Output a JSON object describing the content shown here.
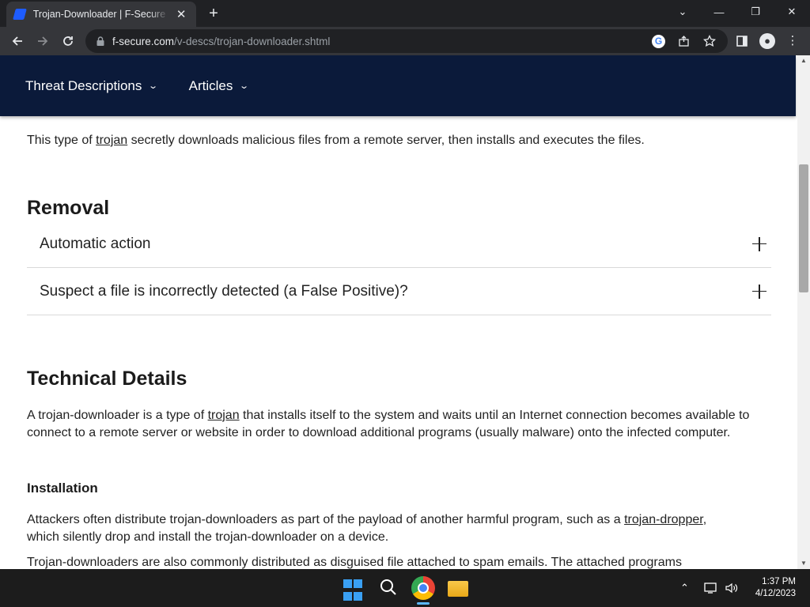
{
  "browser": {
    "tab_title": "Trojan-Downloader | F-Secure Labs",
    "tab_close": "✕",
    "new_tab": "+",
    "url_host": "f-secure.com",
    "url_path": "/v-descs/trojan-downloader.shtml",
    "window_controls": {
      "tab_search": "⌄",
      "minimize": "—",
      "restore": "❐",
      "close": "✕"
    }
  },
  "site_nav": {
    "items": [
      {
        "label": "Threat Descriptions"
      },
      {
        "label": "Articles"
      }
    ]
  },
  "article": {
    "intro_pre": "This type of ",
    "intro_link": "trojan",
    "intro_post": " secretly downloads malicious files from a remote server, then installs and executes the files.",
    "removal_heading": "Removal",
    "accordion": [
      {
        "label": "Automatic action"
      },
      {
        "label": "Suspect a file is incorrectly detected (a False Positive)?"
      }
    ],
    "tech_heading": "Technical Details",
    "tech_pre": "A trojan-downloader is a type of ",
    "tech_link": "trojan",
    "tech_post": " that installs itself to the system and waits until an Internet connection becomes available to connect to a remote server or website in order to download additional programs (usually malware) onto the infected computer.",
    "install_heading": "Installation",
    "install_pre": "Attackers often distribute trojan-downloaders as part of the payload of another harmful program, such as a ",
    "install_link": "trojan-dropper",
    "install_post": ", which silently drop and install the trojan-downloader on a device.",
    "last_para": "Trojan-downloaders are also commonly distributed as disguised file attached to spam emails. The attached programs"
  },
  "taskbar": {
    "time": "1:37 PM",
    "date": "4/12/2023"
  },
  "colors": {
    "site_nav_bg": "#0b1a3a",
    "chrome_dark": "#202124",
    "chrome_toolbar": "#35363a"
  }
}
